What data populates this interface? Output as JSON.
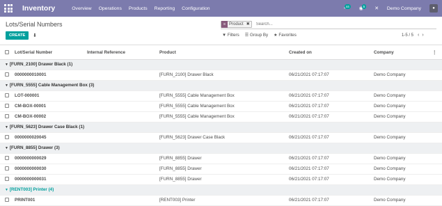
{
  "navbar": {
    "brand": "Inventory",
    "menu": [
      "Overview",
      "Operations",
      "Products",
      "Reporting",
      "Configuration"
    ],
    "chat_badge": "44",
    "activity_badge": "5",
    "company": "Demo Company"
  },
  "control": {
    "breadcrumb": "Lots/Serial Numbers",
    "search": {
      "facet_value": "Product",
      "placeholder": "Search..."
    },
    "create_label": "CREATE",
    "filters_label": "Filters",
    "groupby_label": "Group By",
    "favorites_label": "Favorites",
    "pager": "1-5 / 5"
  },
  "table": {
    "headers": [
      "Lot/Serial Number",
      "Internal Reference",
      "Product",
      "Created on",
      "Company"
    ],
    "groups": [
      {
        "label": "[FURN_2100] Drawer Black (1)",
        "rows": [
          [
            "0000000010001",
            "",
            "[FURN_2100] Drawer Black",
            "06/21/2021 07:17:07",
            "Demo Company"
          ]
        ]
      },
      {
        "label": "[FURN_5555] Cable Management Box (3)",
        "rows": [
          [
            "LOT-000001",
            "",
            "[FURN_5555] Cable Management Box",
            "06/21/2021 07:17:07",
            "Demo Company"
          ],
          [
            "CM-BOX-00001",
            "",
            "[FURN_5555] Cable Management Box",
            "06/21/2021 07:17:07",
            "Demo Company"
          ],
          [
            "CM-BOX-00002",
            "",
            "[FURN_5555] Cable Management Box",
            "06/21/2021 07:17:07",
            "Demo Company"
          ]
        ]
      },
      {
        "label": "[FURN_5623] Drawer Case Black (1)",
        "rows": [
          [
            "0000000020045",
            "",
            "[FURN_5623] Drawer Case Black",
            "06/21/2021 07:17:07",
            "Demo Company"
          ]
        ]
      },
      {
        "label": "[FURN_8855] Drawer (3)",
        "rows": [
          [
            "0000000000029",
            "",
            "[FURN_8855] Drawer",
            "06/21/2021 07:17:07",
            "Demo Company"
          ],
          [
            "0000000000030",
            "",
            "[FURN_8855] Drawer",
            "06/21/2021 07:17:07",
            "Demo Company"
          ],
          [
            "0000000000031",
            "",
            "[FURN_8855] Drawer",
            "06/21/2021 07:17:07",
            "Demo Company"
          ]
        ]
      },
      {
        "label": "[RENT003] Printer (4)",
        "highlight": true,
        "rows": [
          [
            "PRINT001",
            "",
            "[RENT003] Printer",
            "06/21/2021 07:17:07",
            "Demo Company"
          ]
        ]
      }
    ]
  }
}
